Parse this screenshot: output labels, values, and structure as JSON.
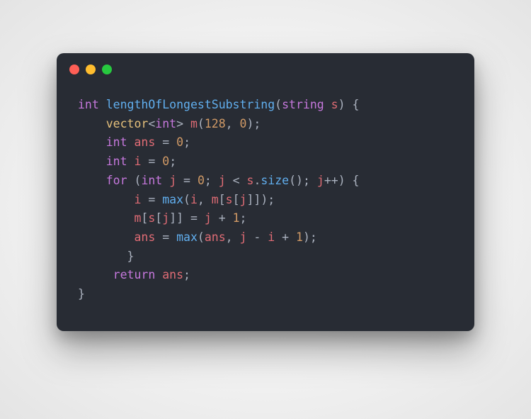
{
  "window": {
    "dots": [
      "red",
      "yellow",
      "green"
    ]
  },
  "code": {
    "language": "cpp",
    "tokens": [
      {
        "t": "kw",
        "v": "int"
      },
      {
        "t": "op",
        "v": " "
      },
      {
        "t": "fn",
        "v": "lengthOfLongestSubstring"
      },
      {
        "t": "pun",
        "v": "("
      },
      {
        "t": "type",
        "v": "string"
      },
      {
        "t": "op",
        "v": " "
      },
      {
        "t": "var",
        "v": "s"
      },
      {
        "t": "pun",
        "v": ") {"
      },
      {
        "t": "nl"
      },
      {
        "t": "op",
        "v": "    "
      },
      {
        "t": "builtin",
        "v": "vector"
      },
      {
        "t": "pun",
        "v": "<"
      },
      {
        "t": "kw",
        "v": "int"
      },
      {
        "t": "pun",
        "v": "> "
      },
      {
        "t": "var",
        "v": "m"
      },
      {
        "t": "pun",
        "v": "("
      },
      {
        "t": "num",
        "v": "128"
      },
      {
        "t": "pun",
        "v": ", "
      },
      {
        "t": "num",
        "v": "0"
      },
      {
        "t": "pun",
        "v": ");"
      },
      {
        "t": "nl"
      },
      {
        "t": "op",
        "v": "    "
      },
      {
        "t": "kw",
        "v": "int"
      },
      {
        "t": "op",
        "v": " "
      },
      {
        "t": "var",
        "v": "ans"
      },
      {
        "t": "op",
        "v": " = "
      },
      {
        "t": "num",
        "v": "0"
      },
      {
        "t": "pun",
        "v": ";"
      },
      {
        "t": "nl"
      },
      {
        "t": "op",
        "v": "    "
      },
      {
        "t": "kw",
        "v": "int"
      },
      {
        "t": "op",
        "v": " "
      },
      {
        "t": "var",
        "v": "i"
      },
      {
        "t": "op",
        "v": " = "
      },
      {
        "t": "num",
        "v": "0"
      },
      {
        "t": "pun",
        "v": ";"
      },
      {
        "t": "nl"
      },
      {
        "t": "op",
        "v": "    "
      },
      {
        "t": "kw",
        "v": "for"
      },
      {
        "t": "pun",
        "v": " ("
      },
      {
        "t": "kw",
        "v": "int"
      },
      {
        "t": "op",
        "v": " "
      },
      {
        "t": "var",
        "v": "j"
      },
      {
        "t": "op",
        "v": " = "
      },
      {
        "t": "num",
        "v": "0"
      },
      {
        "t": "pun",
        "v": "; "
      },
      {
        "t": "var",
        "v": "j"
      },
      {
        "t": "op",
        "v": " < "
      },
      {
        "t": "var",
        "v": "s"
      },
      {
        "t": "pun",
        "v": "."
      },
      {
        "t": "fn",
        "v": "size"
      },
      {
        "t": "pun",
        "v": "(); "
      },
      {
        "t": "var",
        "v": "j"
      },
      {
        "t": "op",
        "v": "++"
      },
      {
        "t": "pun",
        "v": ") {"
      },
      {
        "t": "nl"
      },
      {
        "t": "op",
        "v": "        "
      },
      {
        "t": "var",
        "v": "i"
      },
      {
        "t": "op",
        "v": " = "
      },
      {
        "t": "fn",
        "v": "max"
      },
      {
        "t": "pun",
        "v": "("
      },
      {
        "t": "var",
        "v": "i"
      },
      {
        "t": "pun",
        "v": ", "
      },
      {
        "t": "var",
        "v": "m"
      },
      {
        "t": "pun",
        "v": "["
      },
      {
        "t": "var",
        "v": "s"
      },
      {
        "t": "pun",
        "v": "["
      },
      {
        "t": "var",
        "v": "j"
      },
      {
        "t": "pun",
        "v": "]]);"
      },
      {
        "t": "nl"
      },
      {
        "t": "op",
        "v": "        "
      },
      {
        "t": "var",
        "v": "m"
      },
      {
        "t": "pun",
        "v": "["
      },
      {
        "t": "var",
        "v": "s"
      },
      {
        "t": "pun",
        "v": "["
      },
      {
        "t": "var",
        "v": "j"
      },
      {
        "t": "pun",
        "v": "]] = "
      },
      {
        "t": "var",
        "v": "j"
      },
      {
        "t": "op",
        "v": " + "
      },
      {
        "t": "num",
        "v": "1"
      },
      {
        "t": "pun",
        "v": ";"
      },
      {
        "t": "nl"
      },
      {
        "t": "op",
        "v": "        "
      },
      {
        "t": "var",
        "v": "ans"
      },
      {
        "t": "op",
        "v": " = "
      },
      {
        "t": "fn",
        "v": "max"
      },
      {
        "t": "pun",
        "v": "("
      },
      {
        "t": "var",
        "v": "ans"
      },
      {
        "t": "pun",
        "v": ", "
      },
      {
        "t": "var",
        "v": "j"
      },
      {
        "t": "op",
        "v": " - "
      },
      {
        "t": "var",
        "v": "i"
      },
      {
        "t": "op",
        "v": " + "
      },
      {
        "t": "num",
        "v": "1"
      },
      {
        "t": "pun",
        "v": ");"
      },
      {
        "t": "nl"
      },
      {
        "t": "op",
        "v": "       "
      },
      {
        "t": "pun",
        "v": "}"
      },
      {
        "t": "nl"
      },
      {
        "t": "op",
        "v": "     "
      },
      {
        "t": "kw",
        "v": "return"
      },
      {
        "t": "op",
        "v": " "
      },
      {
        "t": "var",
        "v": "ans"
      },
      {
        "t": "pun",
        "v": ";"
      },
      {
        "t": "nl"
      },
      {
        "t": "pun",
        "v": "}"
      }
    ]
  }
}
